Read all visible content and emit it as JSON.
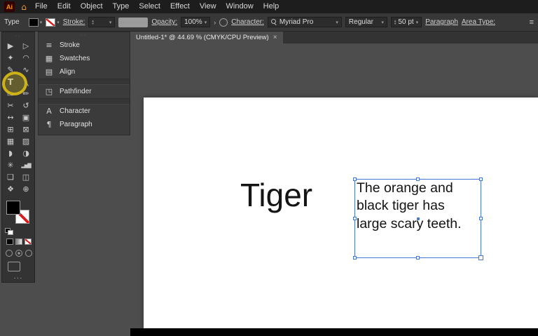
{
  "app": {
    "logo_text": "Ai"
  },
  "glyphs": {
    "caret": "▾",
    "stepper_up": "▴",
    "stepper_down": "▾",
    "flyout": "›",
    "menu_lines": "≡",
    "home": "⌂",
    "close": "×",
    "drag_dots": "··",
    "more_dots": "···"
  },
  "menubar": {
    "items": [
      "File",
      "Edit",
      "Object",
      "Type",
      "Select",
      "Effect",
      "View",
      "Window",
      "Help"
    ]
  },
  "control_bar": {
    "tool_label": "Type",
    "stroke_label": "Stroke:",
    "opacity_label": "Opacity:",
    "opacity_value": "100%",
    "character_label": "Character:",
    "font_family": "Myriad Pro",
    "font_style": "Regular",
    "font_size": "50 pt",
    "paragraph_label": "Paragraph",
    "area_type_label": "Area Type:"
  },
  "document": {
    "tab_title": "Untitled-1* @ 44.69 % (CMYK/CPU Preview)"
  },
  "toolbar": {
    "tools": [
      {
        "name": "selection",
        "glyph": "▶"
      },
      {
        "name": "direct-selection",
        "glyph": "▷"
      },
      {
        "name": "magic-wand",
        "glyph": "✦"
      },
      {
        "name": "lasso",
        "glyph": "◠"
      },
      {
        "name": "pen",
        "glyph": "✎"
      },
      {
        "name": "curvature",
        "glyph": "∿"
      },
      {
        "name": "type",
        "glyph": "T"
      },
      {
        "name": "line-segment",
        "glyph": "╲"
      },
      {
        "name": "rectangle",
        "glyph": "▭"
      },
      {
        "name": "paintbrush",
        "glyph": "✏"
      },
      {
        "name": "scissors",
        "glyph": "✂"
      },
      {
        "name": "rotate",
        "glyph": "↺"
      },
      {
        "name": "width",
        "glyph": "↔"
      },
      {
        "name": "free-transform",
        "glyph": "▣"
      },
      {
        "name": "shape-builder",
        "glyph": "⊞"
      },
      {
        "name": "perspective-grid",
        "glyph": "⊠"
      },
      {
        "name": "mesh",
        "glyph": "▦"
      },
      {
        "name": "gradient",
        "glyph": "▨"
      },
      {
        "name": "eyedropper",
        "glyph": "◗"
      },
      {
        "name": "blend",
        "glyph": "◑"
      },
      {
        "name": "symbol-sprayer",
        "glyph": "✳"
      },
      {
        "name": "column-graph",
        "glyph": "▂▅▇"
      },
      {
        "name": "artboard",
        "glyph": "❏"
      },
      {
        "name": "slice",
        "glyph": "◫"
      },
      {
        "name": "hand",
        "glyph": "❖"
      },
      {
        "name": "zoom",
        "glyph": "⊕"
      }
    ]
  },
  "panels": {
    "items": [
      {
        "label": "Stroke",
        "glyph": "≡"
      },
      {
        "label": "Swatches",
        "glyph": "▦"
      },
      {
        "label": "Align",
        "glyph": "▤"
      },
      {
        "label": "Pathfinder",
        "glyph": "◳"
      },
      {
        "label": "Character",
        "glyph": "A"
      },
      {
        "label": "Paragraph",
        "glyph": "¶"
      }
    ]
  },
  "canvas": {
    "heading": "Tiger",
    "text_lines": [
      "The orange and",
      "black tiger has",
      "large scary teeth."
    ]
  },
  "colors": {
    "selection_blue": "#4576d8",
    "annotation_yellow": "#d8bc14",
    "artboard_white": "#ffffff"
  }
}
